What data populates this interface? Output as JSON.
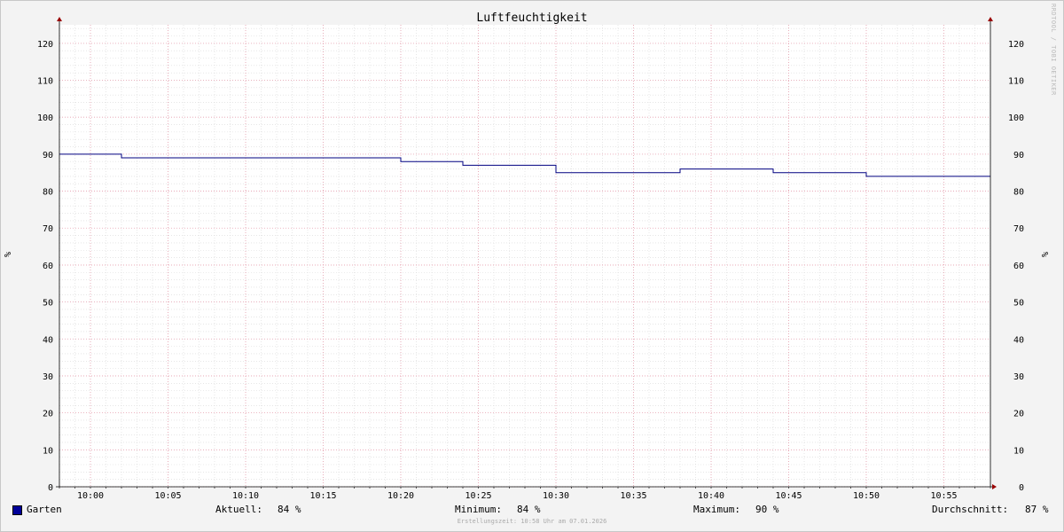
{
  "chart_data": {
    "type": "line",
    "title": "Luftfeuchtigkeit",
    "ylabel": "%",
    "ylim": [
      0,
      125
    ],
    "yticks": [
      0,
      10,
      20,
      30,
      40,
      50,
      60,
      70,
      80,
      90,
      100,
      110,
      120
    ],
    "xlabels": [
      "10:00",
      "10:05",
      "10:10",
      "10:15",
      "10:20",
      "10:25",
      "10:30",
      "10:35",
      "10:40",
      "10:45",
      "10:50",
      "10:55"
    ],
    "grid": true,
    "series": [
      {
        "name": "Garten",
        "color": "#000080",
        "points": [
          [
            "09:58",
            90
          ],
          [
            "10:02",
            90
          ],
          [
            "10:02",
            89
          ],
          [
            "10:20",
            89
          ],
          [
            "10:20",
            88
          ],
          [
            "10:24",
            88
          ],
          [
            "10:24",
            87
          ],
          [
            "10:30",
            87
          ],
          [
            "10:30",
            85
          ],
          [
            "10:38",
            85
          ],
          [
            "10:38",
            86
          ],
          [
            "10:44",
            86
          ],
          [
            "10:44",
            85
          ],
          [
            "10:50",
            85
          ],
          [
            "10:50",
            84
          ],
          [
            "10:58",
            84
          ]
        ]
      }
    ]
  },
  "legend": {
    "name": "Garten",
    "current_label": "Aktuell:",
    "current_value": "84 %",
    "min_label": "Minimum:",
    "min_value": "84 %",
    "max_label": "Maximum:",
    "max_value": "90 %",
    "avg_label": "Durchschnitt:",
    "avg_value": "87 %"
  },
  "footer": "Erstellungszeit: 10:58 Uhr am 07.01.2026",
  "watermark": "RRDTOOL / TOBI OETIKER",
  "colors": {
    "minor_grid": "#d8d8d8",
    "major_grid": "#e8a0b0",
    "axis_arrow": "#990000",
    "line": "#000080"
  }
}
